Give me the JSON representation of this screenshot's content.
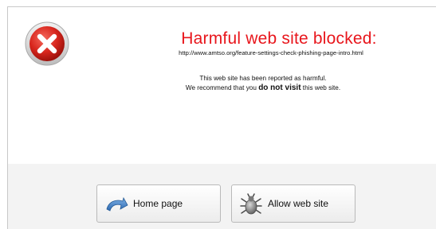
{
  "alert": {
    "title": "Harmful web site blocked:",
    "url": "http://www.amtso.org/feature-settings-check-phishing-page-intro.html",
    "message_line1": "This web site has been reported as harmful.",
    "message_line2_prefix": "We recommend that you ",
    "message_line2_emphasis": "do not visit",
    "message_line2_suffix": " this web site.",
    "icon": "error-x-icon",
    "title_color": "#e8161c"
  },
  "buttons": {
    "home": {
      "label": "Home page",
      "icon": "home-arrow-icon"
    },
    "allow": {
      "label": "Allow web site",
      "icon": "bug-icon"
    }
  }
}
